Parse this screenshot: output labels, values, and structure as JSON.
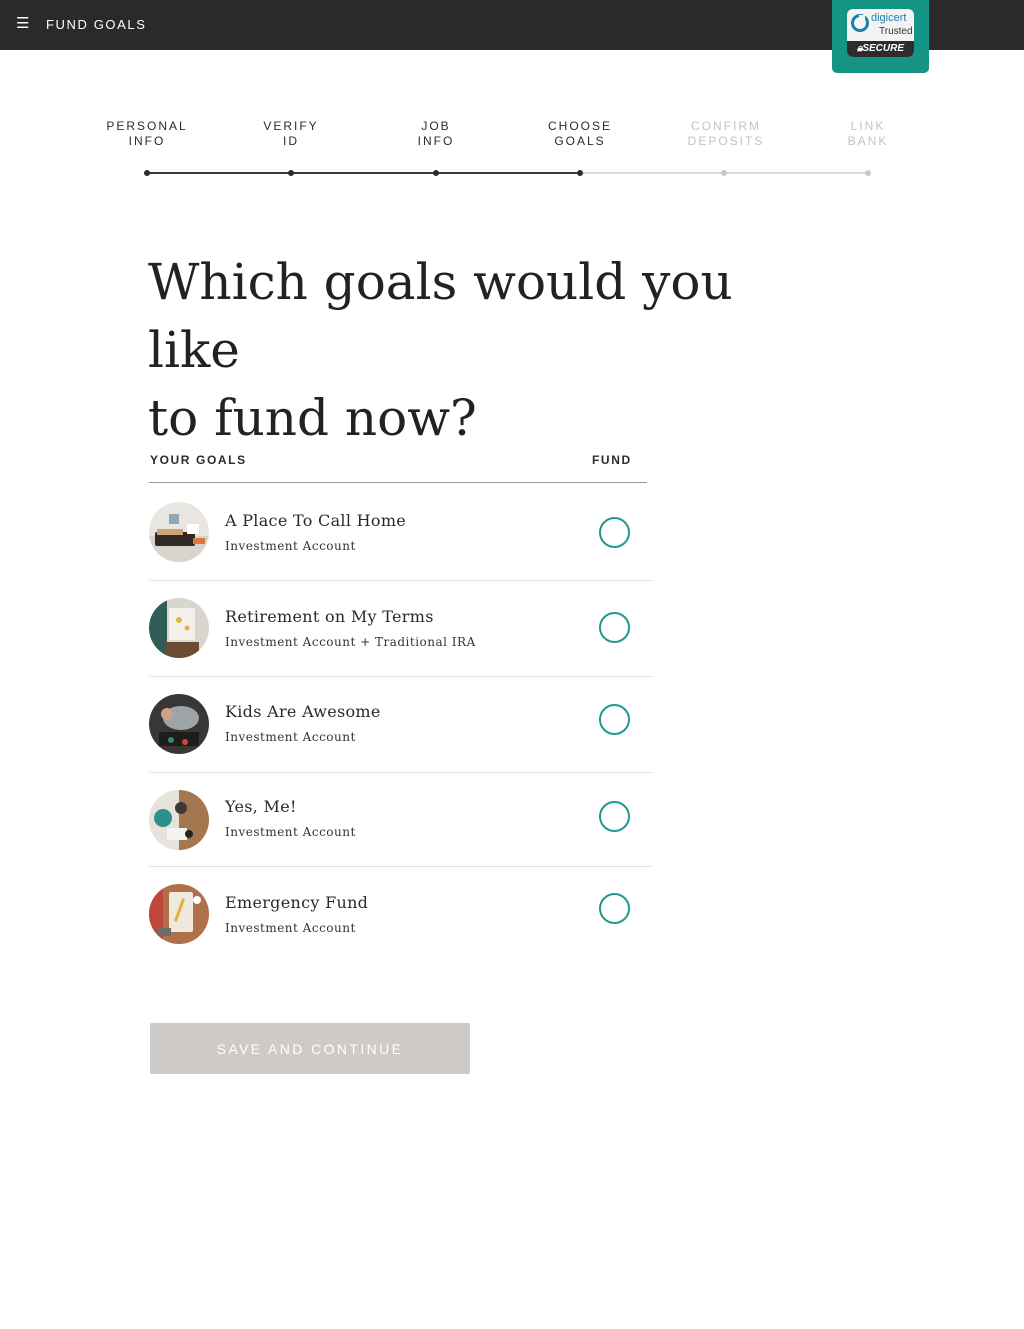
{
  "header": {
    "title": "FUND GOALS",
    "menu_icon": "hamburger-icon"
  },
  "badge": {
    "brand": "digicert",
    "trusted": "Trusted",
    "secure": "SECURE",
    "accent": "#159486"
  },
  "steps": [
    {
      "line1": "PERSONAL",
      "line2": "INFO",
      "state": "complete"
    },
    {
      "line1": "VERIFY",
      "line2": "ID",
      "state": "complete"
    },
    {
      "line1": "JOB",
      "line2": "INFO",
      "state": "complete"
    },
    {
      "line1": "CHOOSE",
      "line2": "GOALS",
      "state": "current"
    },
    {
      "line1": "CONFIRM",
      "line2": "DEPOSITS",
      "state": "upcoming"
    },
    {
      "line1": "LINK",
      "line2": "BANK",
      "state": "upcoming"
    }
  ],
  "heading": {
    "line1": "Which goals would you like",
    "line2": "to fund now?"
  },
  "table": {
    "col_goals": "YOUR GOALS",
    "col_fund": "FUND",
    "rows": [
      {
        "name": "A Place To Call Home",
        "account": "Investment Account",
        "selected": false
      },
      {
        "name": "Retirement on My Terms",
        "account": "Investment Account + Traditional IRA",
        "selected": false
      },
      {
        "name": "Kids Are Awesome",
        "account": "Investment Account",
        "selected": false
      },
      {
        "name": "Yes, Me!",
        "account": "Investment Account",
        "selected": false
      },
      {
        "name": "Emergency Fund",
        "account": "Investment Account",
        "selected": false
      }
    ]
  },
  "actions": {
    "save_label": "SAVE AND CONTINUE"
  },
  "colors": {
    "radio": "#1f9a8c",
    "button_disabled": "#cdcac7",
    "topbar": "#2a2a2a"
  }
}
